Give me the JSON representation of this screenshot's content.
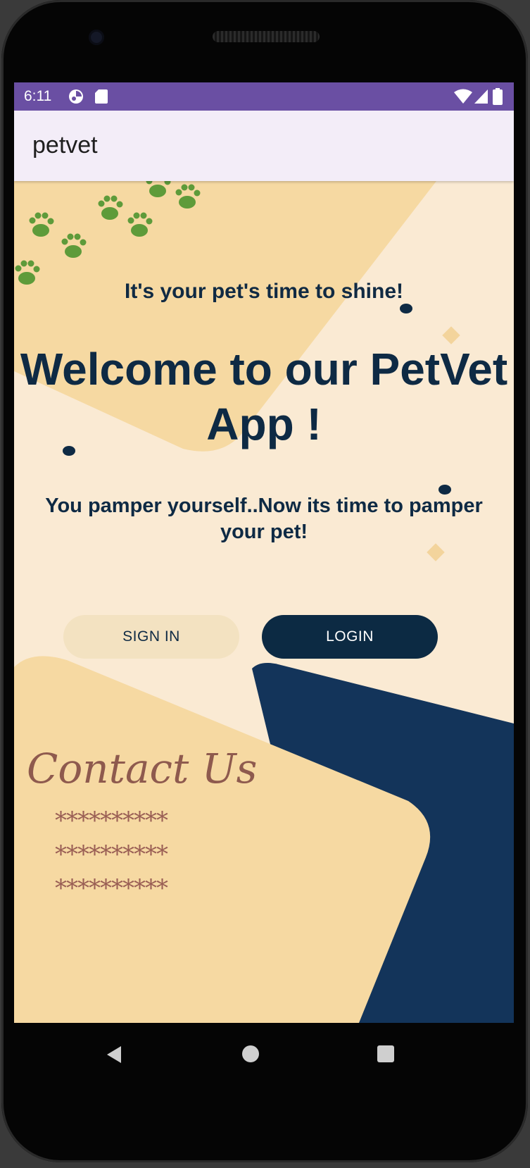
{
  "status_bar": {
    "time": "6:11",
    "icons": [
      "notification-app-icon",
      "sd-card-icon",
      "wifi-icon",
      "signal-icon",
      "battery-icon"
    ],
    "color": "#6a4fa3"
  },
  "app_bar": {
    "title": "petvet"
  },
  "main": {
    "tagline": "It's your pet's time to shine!",
    "welcome_line1": "Welcome to our PetVet",
    "welcome_line2": "App !",
    "pamper_line1": "You pamper yourself..Now its time to pamper",
    "pamper_line2": "your pet!",
    "signin_label": "SIGN IN",
    "login_label": "LOGIN"
  },
  "contact": {
    "title": "Contact Us",
    "lines": [
      "**********",
      "**********",
      "**********"
    ]
  },
  "navigation_bar": {
    "icons": [
      "back-icon",
      "home-icon",
      "recents-icon"
    ]
  },
  "colors": {
    "navy": "#0e2a44",
    "peach": "#f6d9a2",
    "cream": "#faead3",
    "paw_green": "#5e9b3a",
    "contact_brown": "#8e5a4e"
  }
}
